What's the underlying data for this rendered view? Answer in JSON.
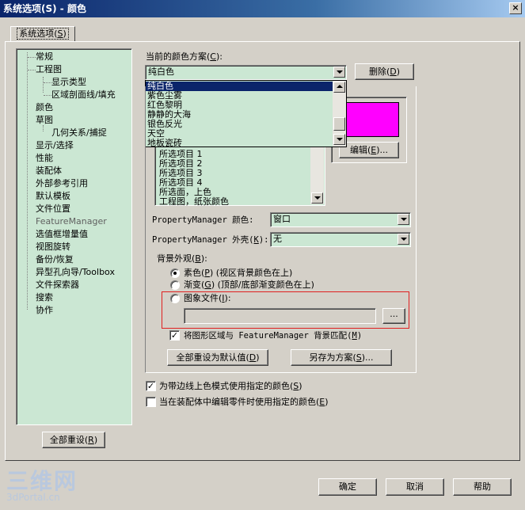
{
  "window": {
    "title": "系统选项(S) - 颜色",
    "close": "×"
  },
  "tabs": [
    {
      "label": "系统选项",
      "hotkey": "S"
    }
  ],
  "tree": {
    "items": [
      {
        "label": "常规"
      },
      {
        "label": "工程图"
      },
      {
        "label": "显示类型"
      },
      {
        "label": "区域剖面线/填充"
      },
      {
        "label": "颜色"
      },
      {
        "label": "草图"
      },
      {
        "label": "几何关系/捕捉"
      },
      {
        "label": "显示/选择"
      },
      {
        "label": "性能"
      },
      {
        "label": "装配体"
      },
      {
        "label": "外部参考引用"
      },
      {
        "label": "默认模板"
      },
      {
        "label": "文件位置"
      },
      {
        "label": "FeatureManager"
      },
      {
        "label": "选值框增量值"
      },
      {
        "label": "视图旋转"
      },
      {
        "label": "备份/恢复"
      },
      {
        "label": "异型孔向导/Toolbox"
      },
      {
        "label": "文件探索器"
      },
      {
        "label": "搜索"
      },
      {
        "label": "协作"
      }
    ]
  },
  "reset_all_tree": {
    "label": "全部重设",
    "hotkey": "R"
  },
  "scheme": {
    "label": "当前的颜色方案",
    "hotkey": "C",
    "value": "纯白色",
    "delete_label": "删除",
    "delete_hotkey": "D",
    "options": [
      "纯白色",
      "紫色尘雾",
      "红色黎明",
      "静静的大海",
      "银色反光",
      "天空",
      "地板瓷砖"
    ]
  },
  "color_list": {
    "items": [
      "所选项目 1",
      "所选项目 2",
      "所选项目 3",
      "所选项目 4",
      "所选面，上色",
      "工程图，纸张颜色"
    ]
  },
  "edit_button": {
    "label": "编辑",
    "hotkey": "E"
  },
  "swatch_color": "#ff00ff",
  "pm_color": {
    "label": "PropertyManager 颜色:",
    "value": "窗口"
  },
  "pm_skin": {
    "label": "PropertyManager 外壳",
    "hotkey": "K",
    "value": "无"
  },
  "background": {
    "label": "背景外观",
    "hotkey": "B",
    "options": [
      {
        "label": "素色",
        "hotkey": "P",
        "desc": "(视区背景颜色在上)",
        "selected": true
      },
      {
        "label": "渐变",
        "hotkey": "G",
        "desc": "(顶部/底部渐变颜色在上)",
        "selected": false
      },
      {
        "label": "图象文件",
        "hotkey": "I",
        "desc": ":",
        "selected": false
      }
    ],
    "browse_label": "...",
    "match_label": "将图形区域与 FeatureManager 背景匹配",
    "match_hotkey": "M",
    "match_checked": true
  },
  "reset_defaults": {
    "label": "全部重设为默认值",
    "hotkey": "D"
  },
  "save_scheme": {
    "label": "另存为方案",
    "hotkey": "S"
  },
  "check1": {
    "label": "为带边线上色模式使用指定的颜色",
    "hotkey": "S",
    "checked": true
  },
  "check2": {
    "label": "当在装配体中编辑零件时使用指定的颜色",
    "hotkey": "E",
    "checked": false
  },
  "footer": {
    "ok": "确定",
    "cancel": "取消",
    "help": "帮助"
  },
  "watermark": {
    "big": "三维网",
    "small": "3dPortal.cn"
  }
}
